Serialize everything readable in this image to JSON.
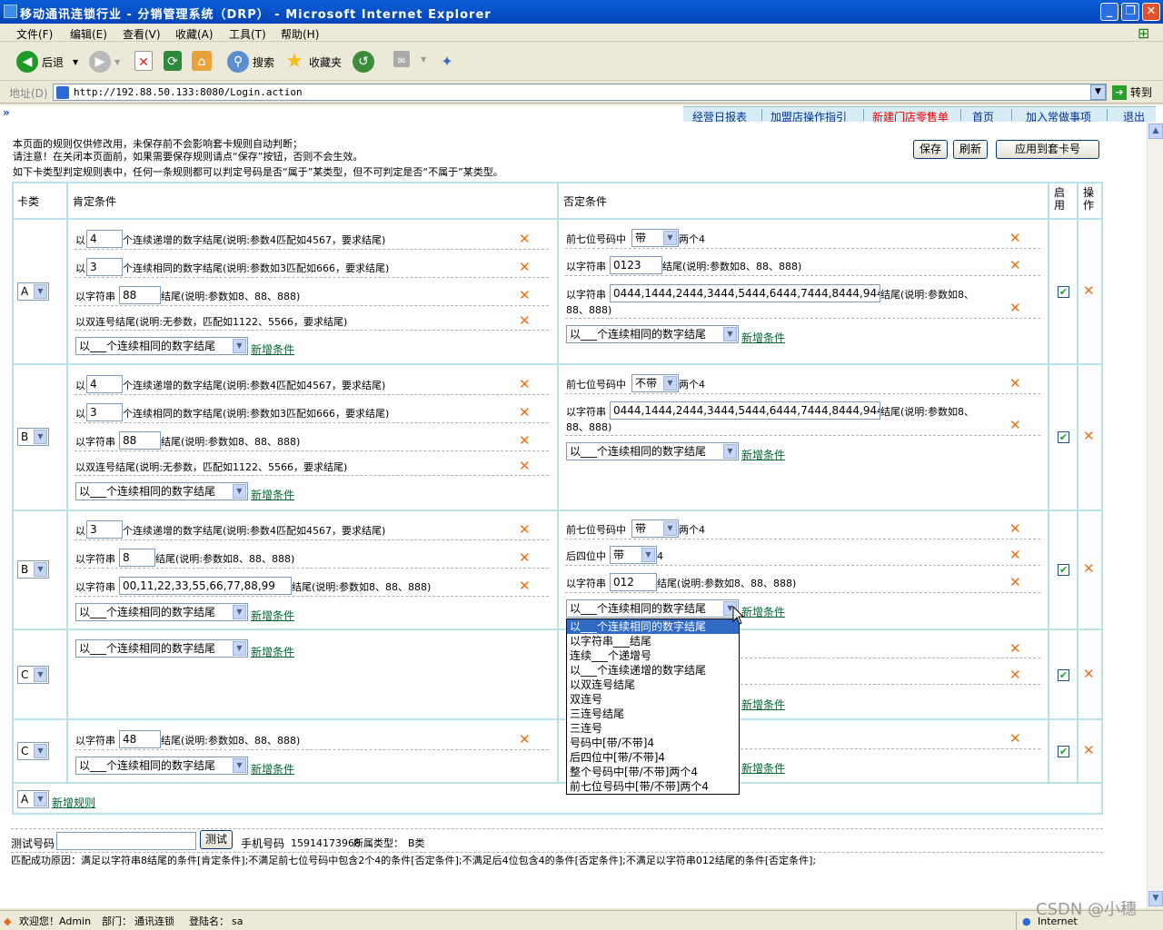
{
  "window": {
    "title": "移动通讯连锁行业 - 分销管理系统（DRP） - Microsoft Internet Explorer"
  },
  "menu": [
    "文件(F)",
    "编辑(E)",
    "查看(V)",
    "收藏(A)",
    "工具(T)",
    "帮助(H)"
  ],
  "toolbar": {
    "back": "后退",
    "search": "搜索",
    "favorites": "收藏夹"
  },
  "address": {
    "label": "地址(D)",
    "url": "http://192.88.50.133:8080/Login.action",
    "go": "转到"
  },
  "nav": {
    "items": [
      "经营日报表",
      "加盟店操作指引",
      "新建门店零售单",
      "首页",
      "加入常做事项",
      "退出"
    ],
    "highlight_color": "#e00000"
  },
  "notes": [
    "本页面的规则仅供修改用，未保存前不会影响套卡规则自动判断；",
    "请注意！在关闭本页面前，如果需要保存规则请点“保存”按钮，否则不会生效。",
    "如下卡类型判定规则表中，任何一条规则都可以判定号码是否“属于”某类型，但不可判定是否“不属于”某类型。"
  ],
  "buttons": {
    "save": "保存",
    "refresh": "刷新",
    "apply": "应用到套卡号"
  },
  "headers": {
    "type": "卡类",
    "positive": "肯定条件",
    "negative": "否定条件",
    "enabled": "启\n用",
    "action": "操\n作"
  },
  "common": {
    "select_default": "以___个连续相同的数字结尾",
    "add_condition": "新增条件",
    "add_rule": "新增规则"
  },
  "rows": [
    {
      "type": "A",
      "pos": [
        {
          "pre": "以",
          "input": "4",
          "post": "个连续递增的数字结尾(说明:参数4匹配如4567，要求结尾)"
        },
        {
          "pre": "以",
          "input": "3",
          "post": "个连续相同的数字结尾(说明:参数如3匹配如666，要求结尾)"
        },
        {
          "pre": "以字符串",
          "input": "88",
          "post": "结尾(说明:参数如8、88、888)"
        },
        {
          "pre": "以双连号结尾(说明:无参数，匹配如1122、5566，要求结尾)"
        }
      ],
      "neg": [
        {
          "pre": "前七位号码中",
          "select": "带",
          "post": "两个4"
        },
        {
          "pre": "以字符串",
          "input": "0123",
          "post": "结尾(说明:参数如8、88、888)"
        },
        {
          "pre": "以字符串",
          "input": "0444,1444,2444,3444,5444,6444,7444,8444,9444",
          "post": "结尾(说明:参数如8、",
          "post2": "88、888)"
        }
      ]
    },
    {
      "type": "B",
      "pos": [
        {
          "pre": "以",
          "input": "4",
          "post": "个连续递增的数字结尾(说明:参数4匹配如4567，要求结尾)"
        },
        {
          "pre": "以",
          "input": "3",
          "post": "个连续相同的数字结尾(说明:参数如3匹配如666，要求结尾)"
        },
        {
          "pre": "以字符串",
          "input": "88",
          "post": "结尾(说明:参数如8、88、888)"
        },
        {
          "pre": "以双连号结尾(说明:无参数，匹配如1122、5566，要求结尾)"
        }
      ],
      "neg": [
        {
          "pre": "前七位号码中",
          "select": "不带",
          "post": "两个4"
        },
        {
          "pre": "以字符串",
          "input": "0444,1444,2444,3444,5444,6444,7444,8444,9444",
          "post": "结尾(说明:参数如8、",
          "post2": "88、888)"
        }
      ]
    },
    {
      "type": "B",
      "pos": [
        {
          "pre": "以",
          "input": "3",
          "post": "个连续递增的数字结尾(说明:参数4匹配如4567，要求结尾)"
        },
        {
          "pre": "以字符串",
          "input": "8",
          "post": "结尾(说明:参数如8、88、888)"
        },
        {
          "pre": "以字符串",
          "input": "00,11,22,33,55,66,77,88,99",
          "post": "结尾(说明:参数如8、88、888)"
        }
      ],
      "neg": [
        {
          "pre": "前七位号码中",
          "select": "带",
          "post": "两个4"
        },
        {
          "pre": "后四位中",
          "select": "带",
          "post": "4"
        },
        {
          "pre": "以字符串",
          "input": "012",
          "post": "结尾(说明:参数如8、88、888)"
        }
      ]
    },
    {
      "type": "C"
    },
    {
      "type": "C",
      "pos": [
        {
          "pre": "以字符串",
          "input": "48",
          "post": "结尾(说明:参数如8、88、888)"
        }
      ]
    }
  ],
  "new_rule_select": "A",
  "dropdown_options": [
    "以___个连续相同的数字结尾",
    "以字符串___结尾",
    "连续___个递增号",
    "以___个连续递增的数字结尾",
    "以双连号结尾",
    "双连号",
    "三连号结尾",
    "三连号",
    "号码中[带/不带]4",
    "后四位中[带/不带]4",
    "整个号码中[带/不带]两个4",
    "前七位号码中[带/不带]两个4"
  ],
  "test": {
    "label": "测试号码",
    "button": "测试",
    "phone_label": "手机号码",
    "phone": "15914173968",
    "type_label": "所属类型：",
    "type": "B类"
  },
  "match_reason": "匹配成功原因：满足以字符串8结尾的条件[肯定条件];不满足前七位号码中包含2个4的条件[否定条件];不满足后4位包含4的条件[否定条件];不满足以字符串012结尾的条件[否定条件];",
  "status": {
    "welcome": "欢迎您！Admin",
    "dept_label": "部门：",
    "dept": "通讯连锁",
    "login_label": "登陆名：",
    "login": "sa",
    "zone": "Internet"
  },
  "watermark": "CSDN @小穗"
}
